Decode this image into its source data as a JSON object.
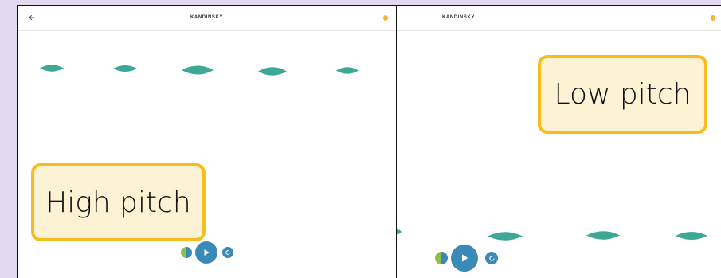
{
  "left_screen": {
    "app_title": "KANDINSKY",
    "annotation": "High pitch"
  },
  "right_screen": {
    "app_title": "KANDINSKY",
    "annotation": "Low pitch"
  },
  "colors": {
    "background": "#e4d8f1",
    "leaf": "#3ea896",
    "accent_blue": "#3a8ab7",
    "label_border": "#f6bd1c",
    "label_fill": "#fdf3d4",
    "coin": "#f2b632"
  },
  "icons": {
    "back": "arrow-left-icon",
    "coin": "coin-icon",
    "color_toggle": "half-circle-color-icon",
    "play": "play-icon",
    "reset": "reset-icon"
  }
}
